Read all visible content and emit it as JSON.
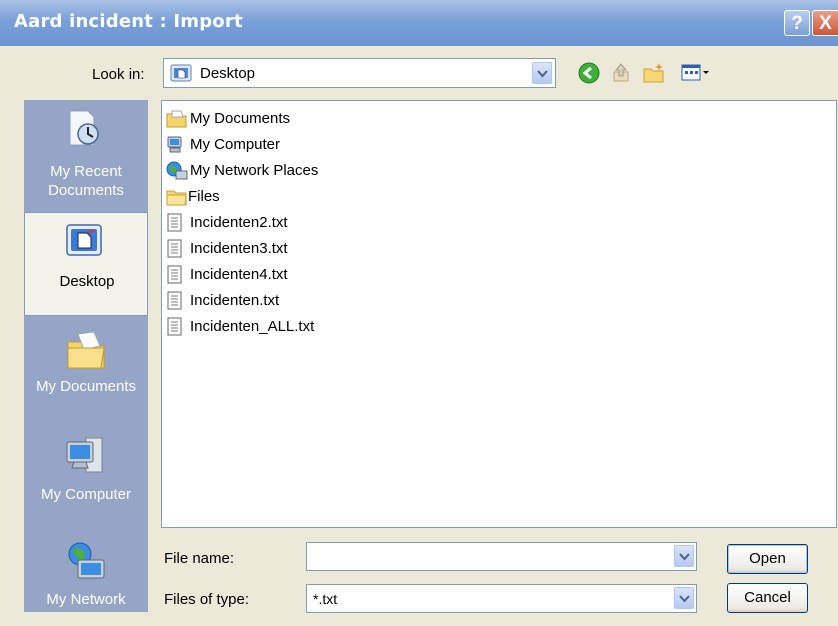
{
  "window": {
    "title": "Aard incident : Import",
    "help_glyph": "?",
    "close_glyph": "X"
  },
  "look_in": {
    "label": "Look in:",
    "value": "Desktop",
    "icon": "desktop-icon"
  },
  "toolbar": {
    "items": [
      "back-icon",
      "up-folder-icon",
      "new-folder-icon",
      "views-menu-icon"
    ]
  },
  "places": [
    {
      "label_line1": "My Recent",
      "label_line2": "Documents",
      "icon": "recent-documents-icon"
    },
    {
      "label_line1": "Desktop",
      "label_line2": "",
      "icon": "desktop-icon",
      "selected": true
    },
    {
      "label_line1": "My Documents",
      "label_line2": "",
      "icon": "my-documents-icon"
    },
    {
      "label_line1": "My Computer",
      "label_line2": "",
      "icon": "my-computer-icon"
    },
    {
      "label_line1": "My Network",
      "label_line2": "",
      "icon": "my-network-icon"
    }
  ],
  "files": [
    {
      "name": "My Documents",
      "icon": "my-documents-icon"
    },
    {
      "name": "My Computer",
      "icon": "my-computer-icon"
    },
    {
      "name": "My Network Places",
      "icon": "network-places-icon"
    },
    {
      "name": "Files",
      "icon": "folder-icon"
    },
    {
      "name": "Incidenten2.txt",
      "icon": "text-file-icon"
    },
    {
      "name": "Incidenten3.txt",
      "icon": "text-file-icon"
    },
    {
      "name": "Incidenten4.txt",
      "icon": "text-file-icon"
    },
    {
      "name": "Incidenten.txt",
      "icon": "text-file-icon"
    },
    {
      "name": "Incidenten_ALL.txt",
      "icon": "text-file-icon"
    }
  ],
  "file_name": {
    "label": "File name:",
    "value": ""
  },
  "file_type": {
    "label": "Files of type:",
    "value": "*.txt"
  },
  "buttons": {
    "open": "Open",
    "cancel": "Cancel"
  },
  "colors": {
    "titlebar": "#7aa0d8",
    "places_bar": "#94a5c5",
    "field_border": "#7f9db9"
  }
}
